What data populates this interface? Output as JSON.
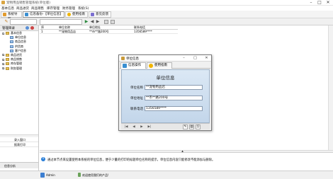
{
  "window": {
    "title": "宠物用品销售管理系统(单位版)",
    "minimize": "–",
    "maximize": "□",
    "close": "✕"
  },
  "menu": [
    "基本信息",
    "商品进货",
    "商品销售",
    "库存管理",
    "财务管理",
    "系统(S)"
  ],
  "toolbar": [
    {
      "label": "系统导航",
      "icon_color": "#e29b2d"
    },
    {
      "label": "信息备份-【单位信息】",
      "icon_color": "#3a8fd1"
    },
    {
      "label": "使用指南",
      "icon_color": "#f0b400"
    },
    {
      "label": "意见反馈",
      "icon_color": "#7b6fd0"
    }
  ],
  "toolbar2": {
    "pencil": "✎",
    "prev": "◀",
    "next": "▶",
    "play": "▶"
  },
  "left_panel": {
    "header": "管理目录",
    "tree": [
      {
        "label": "基本信息",
        "level": 0,
        "expanded": true
      },
      {
        "label": "单位信息",
        "level": 1
      },
      {
        "label": "商品信息",
        "level": 1
      },
      {
        "label": "供货商",
        "level": 1
      },
      {
        "label": "客户信息",
        "level": 1
      },
      {
        "label": "商品进货",
        "level": 0
      },
      {
        "label": "商品销售",
        "level": 0
      },
      {
        "label": "库存管理",
        "level": 0
      },
      {
        "label": "财务管理",
        "level": 0
      }
    ],
    "bottom_items": [
      "录入窗口",
      "报表打印"
    ],
    "tab": "信息分析"
  },
  "grid": {
    "headers": [
      "序",
      "单位名称",
      "单位地址",
      "联系电话"
    ],
    "rows": [
      [
        "1",
        "**宠物用品店",
        "**市**路200号",
        "1356589****"
      ]
    ]
  },
  "dialog": {
    "title": "单位信息",
    "minimize": "–",
    "maximize": "□",
    "close": "✕",
    "tabs": [
      {
        "label": "信息操作",
        "icon_color": "#3a8fd1"
      },
      {
        "label": "使用指南",
        "icon_color": "#f0b400"
      }
    ],
    "heading": "单位信息",
    "fields": [
      {
        "label": "单位名称",
        "value": "**宠物用品店"
      },
      {
        "label": "单位地址",
        "value": "**市**路200号"
      },
      {
        "label": "联系电话",
        "value": "1356589****"
      }
    ],
    "nav": {
      "first": "|◀",
      "prev": "◀",
      "next": "▶",
      "last": "▶|",
      "save": "✎",
      "print": "▤",
      "exit": "⎋"
    }
  },
  "message": {
    "icon": "i",
    "text": "通过本节点来设置使用本系统的单位信息，便于少量的打印的标题单位名称的提示，单位信息内容只能修改不能添加与删除。"
  },
  "status": {
    "user": "Admin",
    "welcome": "欢迎使用我们的产品!"
  }
}
